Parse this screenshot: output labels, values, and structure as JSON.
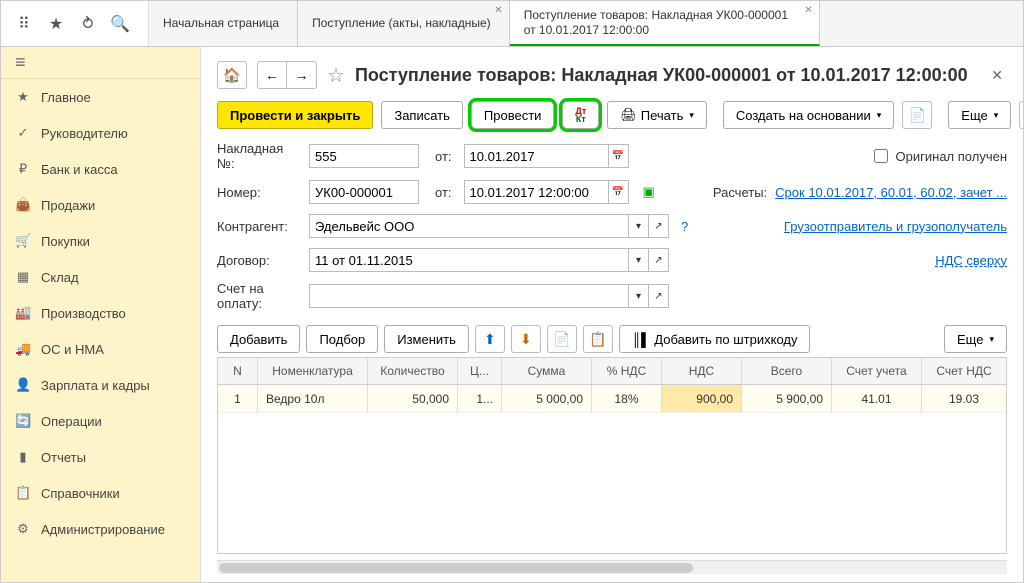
{
  "tabs": {
    "home": "Начальная страница",
    "receipts": "Поступление (акты, накладные)",
    "current": "Поступление товаров: Накладная УК00-000001 от 10.01.2017 12:00:00"
  },
  "sidebar": {
    "items": [
      {
        "label": "Главное",
        "icon": "★"
      },
      {
        "label": "Руководителю",
        "icon": "✓"
      },
      {
        "label": "Банк и касса",
        "icon": "₽"
      },
      {
        "label": "Продажи",
        "icon": "👜"
      },
      {
        "label": "Покупки",
        "icon": "🛒"
      },
      {
        "label": "Склад",
        "icon": "▦"
      },
      {
        "label": "Производство",
        "icon": "🏭"
      },
      {
        "label": "ОС и НМА",
        "icon": "🚚"
      },
      {
        "label": "Зарплата и кадры",
        "icon": "👤"
      },
      {
        "label": "Операции",
        "icon": "🔄"
      },
      {
        "label": "Отчеты",
        "icon": "▮"
      },
      {
        "label": "Справочники",
        "icon": "📋"
      },
      {
        "label": "Администрирование",
        "icon": "⚙"
      }
    ]
  },
  "page": {
    "title": "Поступление товаров: Накладная УК00-000001 от 10.01.2017 12:00:00"
  },
  "toolbar": {
    "post_close": "Провести и закрыть",
    "save": "Записать",
    "post": "Провести",
    "print": "Печать",
    "create_based": "Создать на основании",
    "more": "Еще",
    "help": "?"
  },
  "form": {
    "invoice_lbl": "Накладная №:",
    "invoice_val": "555",
    "from_lbl": "от:",
    "invoice_date": "10.01.2017",
    "original_lbl": "Оригинал получен",
    "number_lbl": "Номер:",
    "number_val": "УК00-000001",
    "datetime_val": "10.01.2017 12:00:00",
    "calc_lbl": "Расчеты:",
    "calc_link": "Срок 10.01.2017, 60.01, 60.02, зачет ...",
    "counterparty_lbl": "Контрагент:",
    "counterparty_val": "Эдельвейс ООО",
    "shipper_link": "Грузоотправитель и грузополучатель",
    "contract_lbl": "Договор:",
    "contract_val": "11 от 01.11.2015",
    "vat_link": "НДС сверху",
    "payacc_lbl": "Счет на оплату:",
    "payacc_val": ""
  },
  "tbl_toolbar": {
    "add": "Добавить",
    "pick": "Подбор",
    "edit": "Изменить",
    "barcode": "Добавить по штрихкоду",
    "more": "Еще"
  },
  "grid": {
    "headers": {
      "n": "N",
      "nom": "Номенклатура",
      "qty": "Количество",
      "price": "Ц...",
      "sum": "Сумма",
      "vatp": "% НДС",
      "vat": "НДС",
      "total": "Всего",
      "acc": "Счет учета",
      "vacc": "Счет НДС"
    },
    "rows": [
      {
        "n": "1",
        "nom": "Ведро 10л",
        "qty": "50,000",
        "price": "1...",
        "sum": "5 000,00",
        "vatp": "18%",
        "vat": "900,00",
        "total": "5 900,00",
        "acc": "41.01",
        "vacc": "19.03"
      }
    ]
  }
}
